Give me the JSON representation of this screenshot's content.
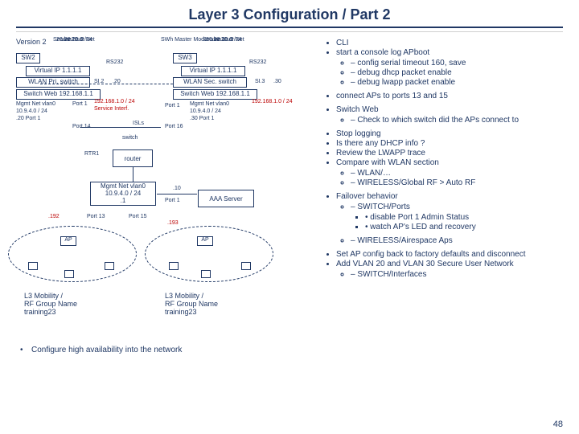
{
  "title": "Layer 3 Configuration / Part 2",
  "version": "Version 2",
  "sun1": {
    "line1": "Secure User Net",
    "line2": "vlan20     .2",
    "line3": "20.20.20.0 /24"
  },
  "sun2": {
    "head": "SWh Master Mode",
    "line1": "Secure User Net",
    "line2": "vlan20     .2",
    "line3": "30.30.30.0 /24"
  },
  "sw2": "SW2",
  "sw3": "SW3",
  "rs232": "RS232",
  "vip": "Virtual IP 1.1.1.1",
  "wlanpri": "WLAN Pri. switch",
  "wlansec": "WLAN Sec. switch",
  "si2": "SI.2",
  "a20": ".20",
  "si3": "SI.3",
  "a30": ".30",
  "sweb": "Switch Web 192.168.1.1",
  "mgmt1": {
    "l1": "Mgmt Net vlan0",
    "l2": "10.9.4.0 / 24",
    "l3": ".20 Port 1"
  },
  "mgmt2": {
    "l1": "Mgmt Net vlan0",
    "l2": "10.9.4.0 / 24",
    "l3": ".30 Port 1"
  },
  "p1a": "Port 1",
  "p1b": "Port 1",
  "p14": "Port 14",
  "p16": "Port 16",
  "badge": "192.168.1.0 / 24",
  "svc": "Service Interf.",
  "isls": "ISLs",
  "switch": "switch",
  "rtr1": "RTR1",
  "router": "router",
  "mgmt0": {
    "l1": "Mgmt Net vlan0",
    "l2": "10.9.4.0 / 24",
    "l3": ".1"
  },
  "p13": "Port 13",
  "p15": "Port 15",
  "d10": ".10",
  "p1c": "Port 1",
  "aaa": "AAA Server",
  "ip192": ".192",
  "ip193": ".193",
  "ap": "AP",
  "g1": {
    "l1": "L3 Mobility /",
    "l2": "RF Group Name",
    "l3": "training23"
  },
  "g2": {
    "l1": "L3 Mobility /",
    "l2": "RF Group Name",
    "l3": "training23"
  },
  "bottom": "Configure high availability into the network",
  "r": {
    "cli": "CLI",
    "start": "start a console log APboot",
    "s1": "config serial timeout 160, save",
    "s2": "debug dhcp packet enable",
    "s3": "debug lwapp packet enable",
    "connect": "connect APs to ports 13 and 15",
    "sweb": "Switch Web",
    "sweb1": "Check to which switch did the APs connect to",
    "stop": "Stop logging",
    "dhcp": "Is there any DHCP info ?",
    "rev": "Review the LWAPP trace",
    "cmp": "Compare with WLAN section",
    "cmp1": "WLAN/…",
    "cmp2": "WIRELESS/Global RF > Auto RF",
    "fail": "Failover behavior",
    "fail1": "SWITCH/Ports",
    "fail1a": "disable Port 1 Admin Status",
    "fail1b": "watch AP's LED and recovery",
    "fail2": "WIRELESS/Airespace Aps",
    "setap": "Set AP config back to factory defaults and disconnect",
    "addv": "Add VLAN 20 and VLAN 30 Secure User Network",
    "addv1": "SWITCH/Interfaces"
  },
  "pageno": "48"
}
